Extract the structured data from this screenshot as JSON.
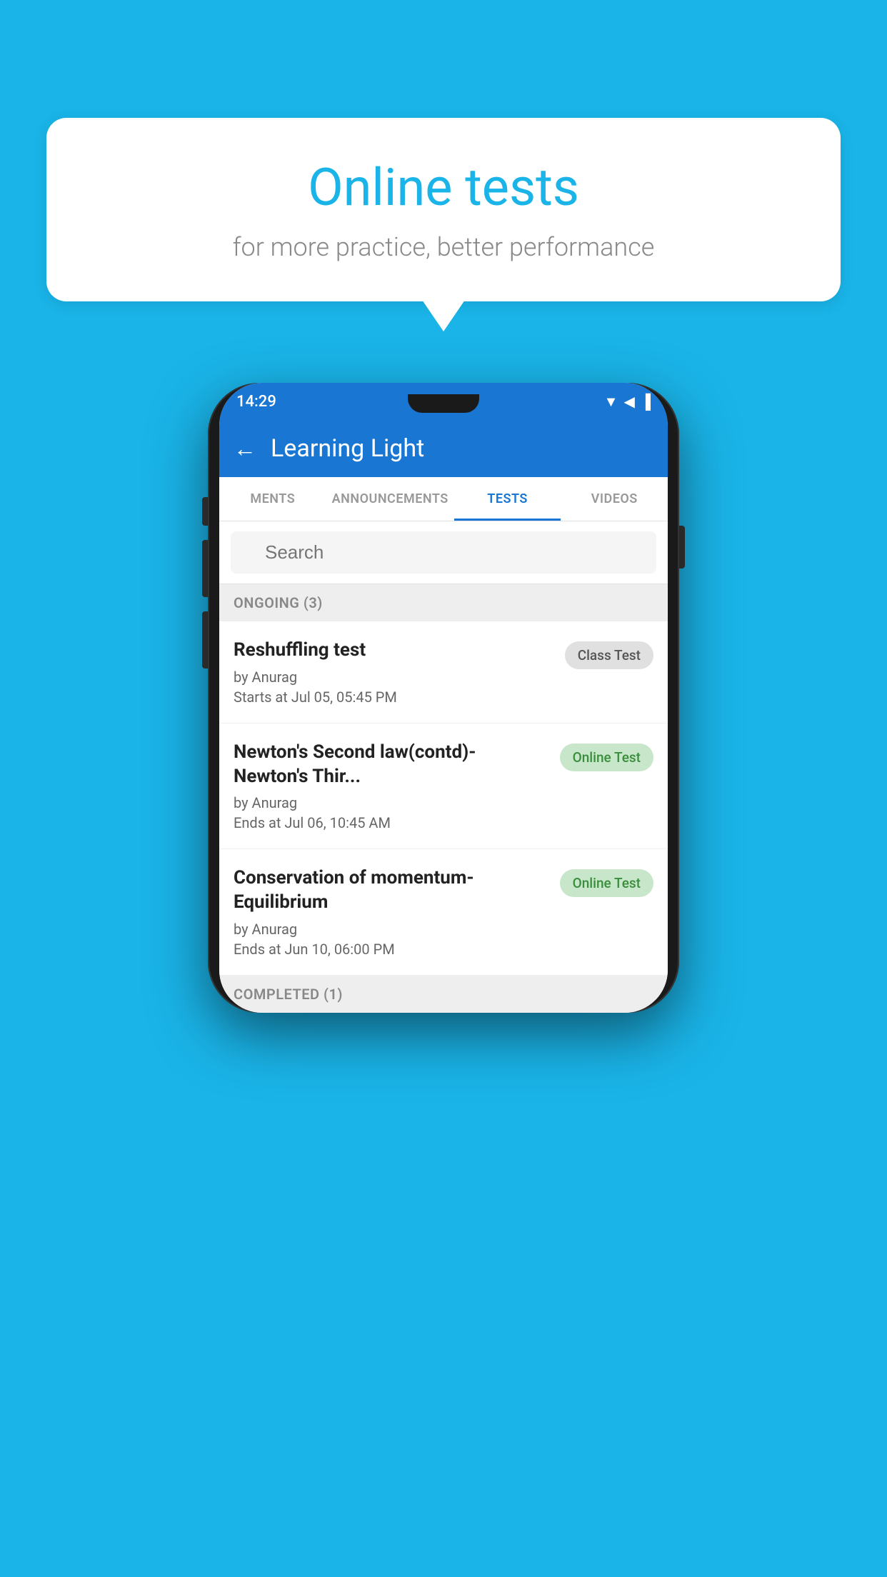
{
  "background_color": "#1ab4e8",
  "bubble": {
    "title": "Online tests",
    "subtitle": "for more practice, better performance"
  },
  "phone": {
    "status_bar": {
      "time": "14:29",
      "icons": "▼◀▐"
    },
    "app_bar": {
      "title": "Learning Light",
      "back_label": "←"
    },
    "tabs": [
      {
        "label": "MENTS",
        "active": false
      },
      {
        "label": "ANNOUNCEMENTS",
        "active": false
      },
      {
        "label": "TESTS",
        "active": true
      },
      {
        "label": "VIDEOS",
        "active": false
      }
    ],
    "search": {
      "placeholder": "Search"
    },
    "ongoing_section": {
      "label": "ONGOING (3)"
    },
    "tests": [
      {
        "name": "Reshuffling test",
        "author": "by Anurag",
        "time_label": "Starts at",
        "time_value": "Jul 05, 05:45 PM",
        "badge_text": "Class Test",
        "badge_type": "class"
      },
      {
        "name": "Newton's Second law(contd)-Newton's Thir...",
        "author": "by Anurag",
        "time_label": "Ends at",
        "time_value": "Jul 06, 10:45 AM",
        "badge_text": "Online Test",
        "badge_type": "online"
      },
      {
        "name": "Conservation of momentum-Equilibrium",
        "author": "by Anurag",
        "time_label": "Ends at",
        "time_value": "Jun 10, 06:00 PM",
        "badge_text": "Online Test",
        "badge_type": "online"
      }
    ],
    "completed_section": {
      "label": "COMPLETED (1)"
    }
  }
}
